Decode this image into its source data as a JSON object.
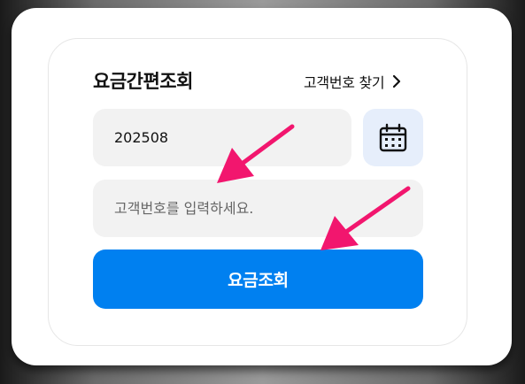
{
  "widget": {
    "title": "요금간편조회",
    "find_customer_link": "고객번호 찾기",
    "date_value": "202508",
    "customer_placeholder": "고객번호를 입력하세요.",
    "search_button_label": "요금조회"
  },
  "icons": {
    "calendar": "calendar-icon",
    "chevron": "chevron-right-icon"
  },
  "colors": {
    "primary": "#0080f0",
    "calendar_bg": "#e6eefb",
    "field_bg": "#f2f2f2",
    "annotation_arrow": "#f2166e"
  }
}
